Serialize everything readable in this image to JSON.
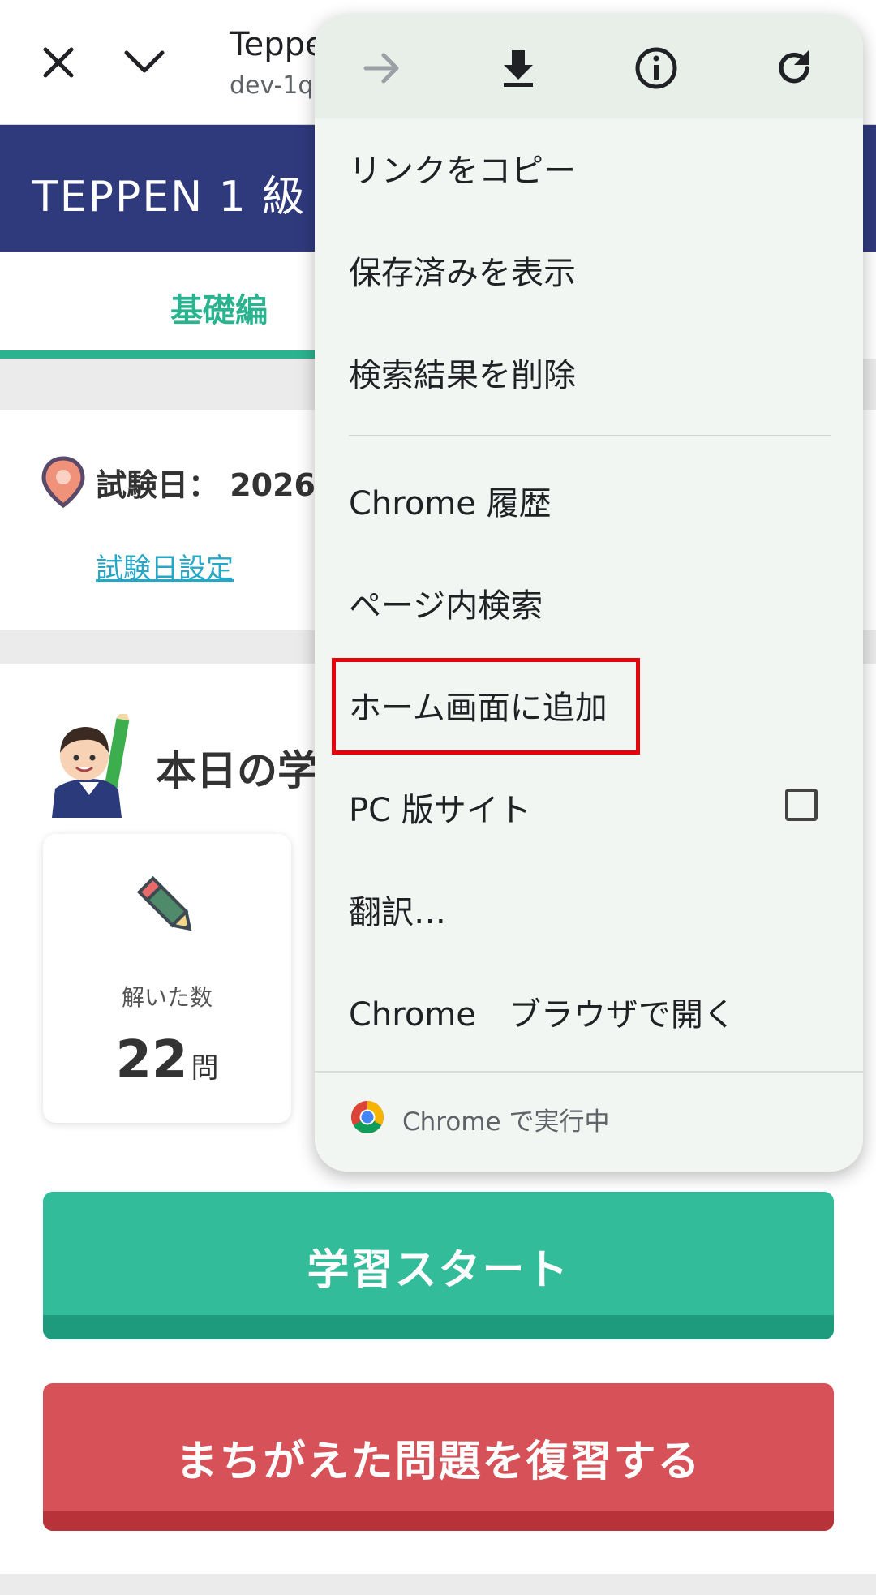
{
  "browser": {
    "title": "Teppe",
    "url": "dev-1q.",
    "close_icon": "close-icon",
    "collapse_icon": "chevron-down-icon"
  },
  "site": {
    "header_title": "TEPPEN 1 級",
    "tab_active": "基礎編",
    "exam_date_label": "試験日： 2026",
    "exam_date_link": "試験日設定",
    "study_heading": "本日の学",
    "stat": {
      "label": "解いた数",
      "value": "22",
      "unit": "問"
    },
    "start_button": "学習スタート",
    "review_button": "まちがえた問題を復習する"
  },
  "menu": {
    "icons": [
      "forward-icon",
      "download-icon",
      "info-icon",
      "refresh-icon"
    ],
    "items": [
      "リンクをコピー",
      "保存済みを表示",
      "検索結果を削除",
      "Chrome 履歴",
      "ページ内検索",
      "ホーム画面に追加",
      "PC 版サイト",
      "翻訳…",
      "Chrome　ブラウザで開く"
    ],
    "pc_site_checked": false,
    "footer": "Chrome で実行中",
    "highlighted_item": "ホーム画面に追加"
  },
  "colors": {
    "header": "#2f3a7d",
    "accent_green": "#2bb38f",
    "start_button": "#33bc9a",
    "review_button": "#d65258",
    "highlight": "#e8000b",
    "link": "#27a7c7"
  }
}
